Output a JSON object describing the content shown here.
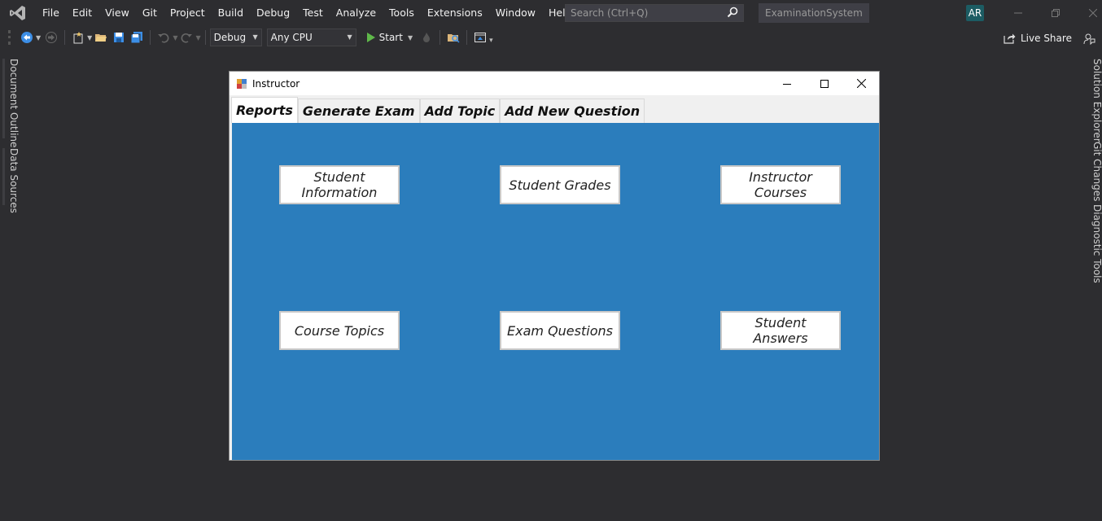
{
  "menubar": {
    "items": [
      "File",
      "Edit",
      "View",
      "Git",
      "Project",
      "Build",
      "Debug",
      "Test",
      "Analyze",
      "Tools",
      "Extensions",
      "Window",
      "Help"
    ],
    "search_placeholder": "Search (Ctrl+Q)",
    "solution_name": "ExaminationSystem",
    "user_initials": "AR"
  },
  "toolbar": {
    "config": "Debug",
    "platform": "Any CPU",
    "start_label": "Start",
    "live_share_label": "Live Share"
  },
  "side_tabs": {
    "left": [
      "Document Outline",
      "Data Sources"
    ],
    "right": [
      "Solution Explorer",
      "Git Changes",
      "Diagnostic Tools"
    ]
  },
  "form": {
    "title": "Instructor",
    "tabs": [
      "Reports",
      "Generate Exam",
      "Add Topic",
      "Add New Question"
    ],
    "active_tab": "Reports",
    "buttons": {
      "student_information": "Student Information",
      "student_grades": "Student Grades",
      "instructor_courses": "Instructor Courses",
      "course_topics": "Course Topics",
      "exam_questions": "Exam Questions",
      "student_answers": "Student Answers"
    },
    "page_color": "#2b7dbc"
  },
  "colors": {
    "ide_background": "#2d2d30",
    "accent": "#2b7dbc"
  }
}
